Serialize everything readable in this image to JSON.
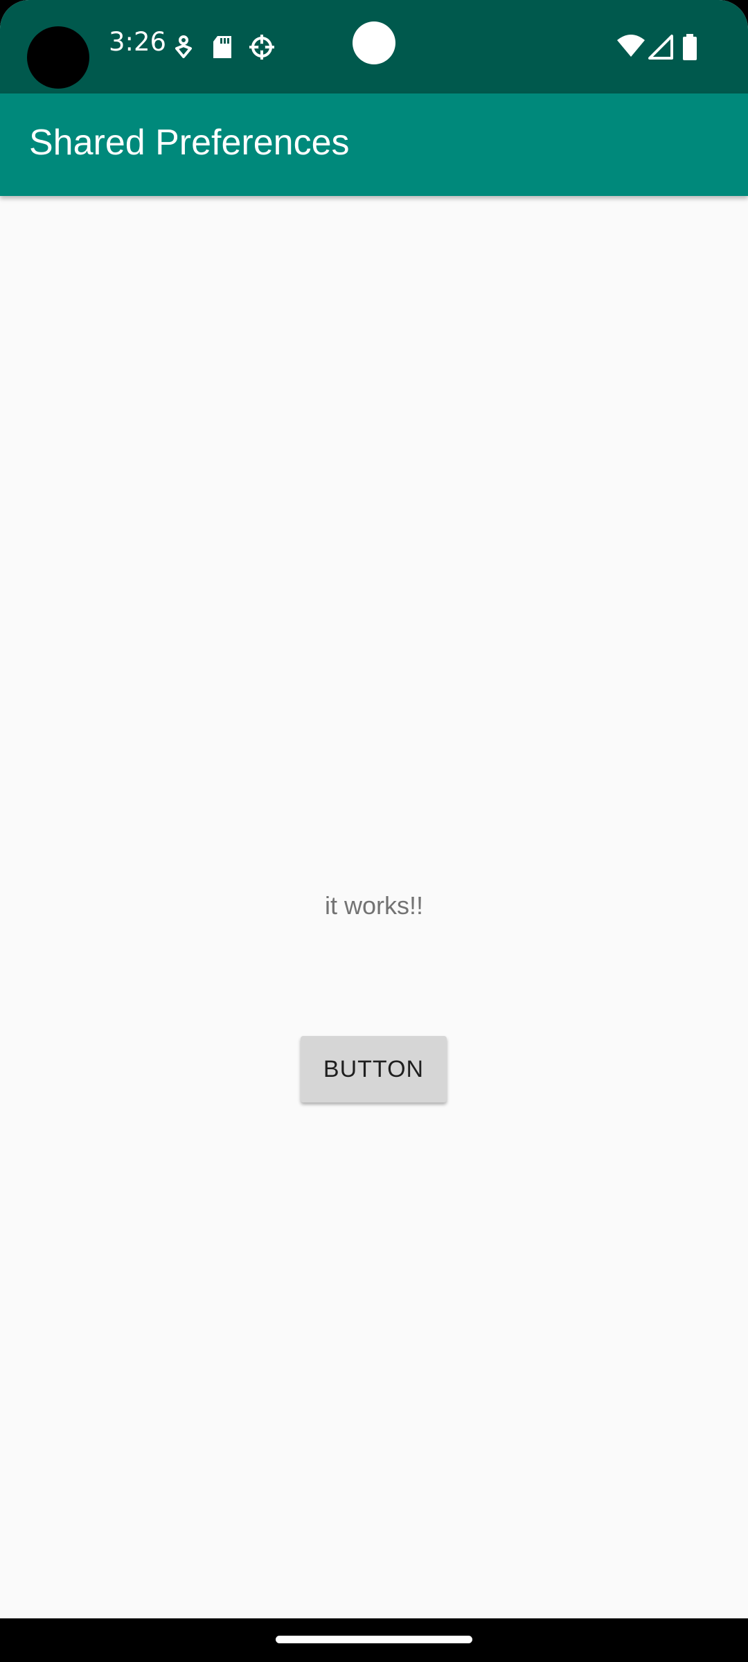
{
  "status_bar": {
    "time": "3:26",
    "icons": [
      "assistant-icon",
      "sd-card-icon",
      "settings-gear-icon",
      "wifi-icon",
      "cell-signal-icon",
      "battery-icon"
    ],
    "background": "#00594d"
  },
  "app_bar": {
    "title": "Shared Preferences",
    "background": "#00897b"
  },
  "main": {
    "message": "it works!!",
    "button_label": "BUTTON"
  },
  "colors": {
    "accent": "#00897b",
    "status": "#00594d",
    "page_bg": "#fafafa",
    "button_bg": "#d6d6d6"
  }
}
